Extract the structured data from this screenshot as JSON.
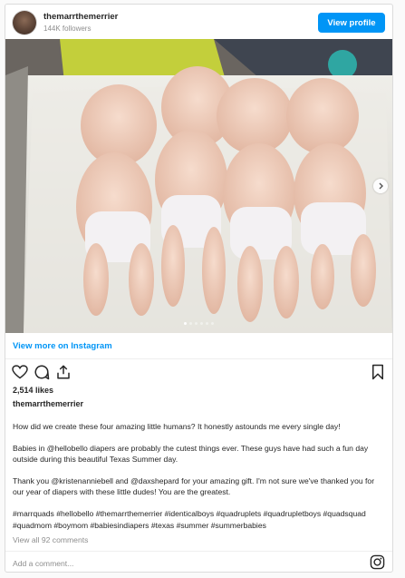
{
  "header": {
    "username": "themarrthemerrier",
    "followers": "144K followers",
    "view_profile_label": "View profile"
  },
  "media": {
    "alt": "Four babies lying together on a white cushion",
    "carousel_dot_count": 6,
    "active_dot_index": 0
  },
  "view_more_label": "View more on Instagram",
  "actions": {
    "icons": [
      "heart-icon",
      "comment-icon",
      "share-icon",
      "bookmark-icon"
    ]
  },
  "likes": "2,514 likes",
  "owner": "themarrthemerrier",
  "caption": {
    "p1": "How did we create these four amazing little humans? It honestly astounds me every single day!",
    "p2": "Babies in @hellobello diapers are probably the cutest things ever. These guys have had such a fun day outside during this beautiful Texas Summer day.",
    "p3": "Thank you @kristenanniebell and @daxshepard for your amazing gift. I'm not sure we've thanked you for our year of diapers with these little dudes! You are the greatest.",
    "hashtags": "#marrquads #hellobello #themarrthemerrier #identicalboys #quadruplets #quadrupletboys #quadsquad #quadmom #boymom #babiesindiapers #texas #summer #summerbabies"
  },
  "view_comments": "View all 92 comments",
  "comment_placeholder": "Add a comment...",
  "colors": {
    "accent": "#0095f6",
    "text": "#262626",
    "muted": "#8e8e8e",
    "border": "#dbdbdb"
  }
}
